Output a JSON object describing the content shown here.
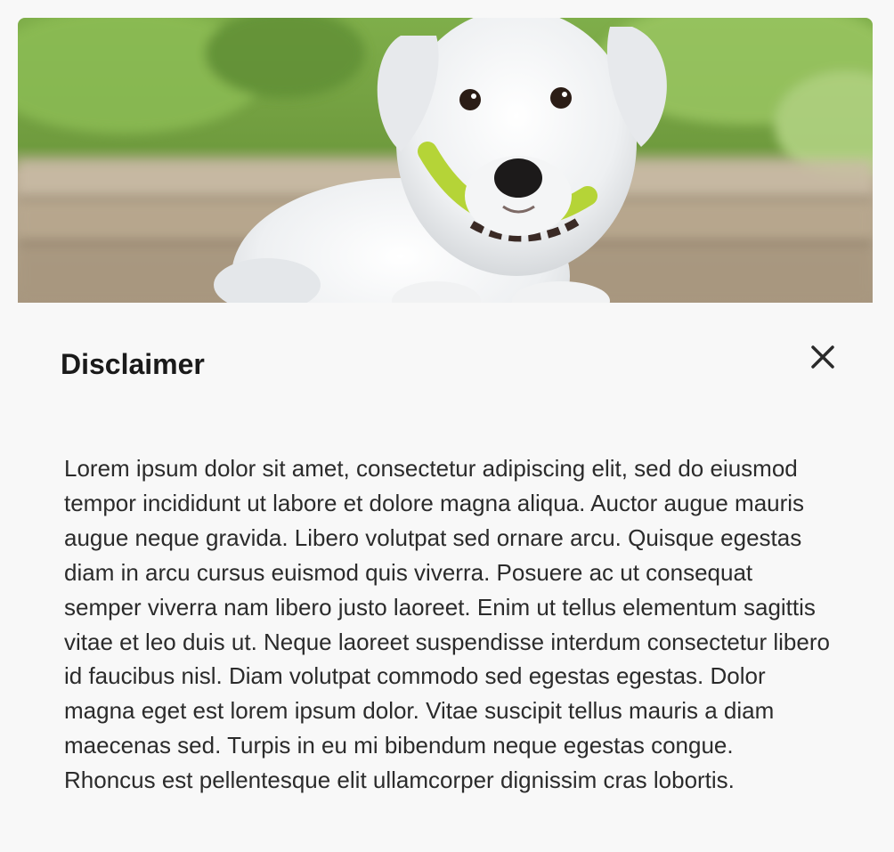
{
  "dialog": {
    "hero_image": "puppy-photo",
    "title": "Disclaimer",
    "close_icon": "close-icon",
    "body": "Lorem ipsum dolor sit amet, consectetur adipiscing elit, sed do eiusmod tempor incididunt ut labore et dolore magna aliqua. Auctor augue mauris augue neque gravida. Libero volutpat sed ornare arcu. Quisque egestas diam in arcu cursus euismod quis viverra. Posuere ac ut consequat semper viverra nam libero justo laoreet. Enim ut tellus elementum sagittis vitae et leo duis ut. Neque laoreet suspendisse interdum consectetur libero id faucibus nisl. Diam volutpat commodo sed egestas egestas. Dolor magna eget est lorem ipsum dolor. Vitae suscipit tellus mauris a diam maecenas sed. Turpis in eu mi bibendum neque egestas congue. Rhoncus est pellentesque elit ullamcorper dignissim cras lobortis."
  },
  "colors": {
    "background": "#f8f8f8",
    "text": "#2b2b2b",
    "heading": "#1a1a1a"
  }
}
